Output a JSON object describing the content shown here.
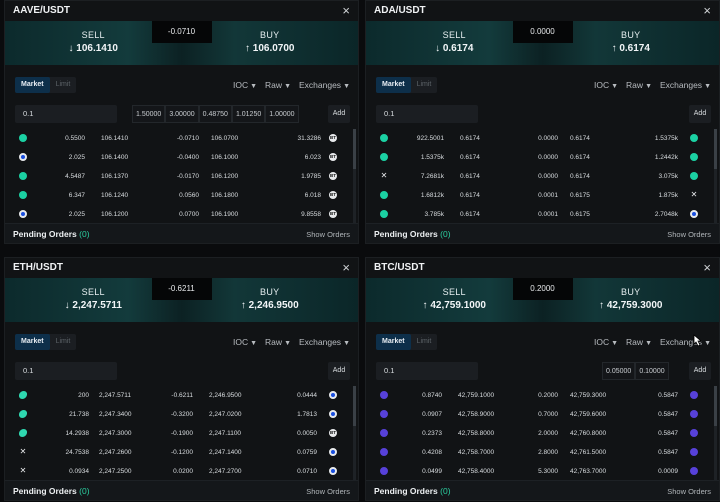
{
  "panels": [
    {
      "title": "AAVE/USDT",
      "sell_label": "SELL",
      "sell_price": "↓ 106.1410",
      "buy_label": "BUY",
      "buy_price": "↑ 106.0700",
      "spread": "-0.0710",
      "tabs": [
        "Market",
        "Limit"
      ],
      "options": [
        "IOC",
        "Raw",
        "Exchanges"
      ],
      "qty": "0.1",
      "presets": [
        "1.50000",
        "3.00000",
        "0.48750",
        "1.01250",
        "1.00000"
      ],
      "add": "Add",
      "rows": [
        {
          "l": "kc",
          "a": "0.5500",
          "b": "106.1410",
          "c": "-0.0710",
          "d": "106.0700",
          "e": "31.3286",
          "r": "bt"
        },
        {
          "l": "cb",
          "a": "2.025",
          "b": "106.1400",
          "c": "-0.0400",
          "d": "106.1000",
          "e": "6.023",
          "r": "bt"
        },
        {
          "l": "kc",
          "a": "4.5487",
          "b": "106.1370",
          "c": "-0.0170",
          "d": "106.1200",
          "e": "1.9785",
          "r": "bt"
        },
        {
          "l": "kc",
          "a": "6.347",
          "b": "106.1240",
          "c": "0.0560",
          "d": "106.1800",
          "e": "6.018",
          "r": "bt"
        },
        {
          "l": "cb",
          "a": "2.025",
          "b": "106.1200",
          "c": "0.0700",
          "d": "106.1900",
          "e": "9.8558",
          "r": "bt"
        }
      ],
      "pending_label": "Pending Orders",
      "pending_count": "(0)",
      "show_orders": "Show Orders"
    },
    {
      "title": "ADA/USDT",
      "sell_label": "SELL",
      "sell_price": "↓ 0.6174",
      "buy_label": "BUY",
      "buy_price": "↑ 0.6174",
      "spread": "0.0000",
      "tabs": [
        "Market",
        "Limit"
      ],
      "options": [
        "IOC",
        "Raw",
        "Exchanges"
      ],
      "qty": "0.1",
      "presets": [],
      "add": "Add",
      "rows": [
        {
          "l": "kc",
          "a": "922.5001",
          "b": "0.6174",
          "c": "0.0000",
          "d": "0.6174",
          "e": "1.5375k",
          "r": "kc"
        },
        {
          "l": "kc",
          "a": "1.5375k",
          "b": "0.6174",
          "c": "0.0000",
          "d": "0.6174",
          "e": "1.2442k",
          "r": "kc"
        },
        {
          "l": "okx",
          "a": "7.2681k",
          "b": "0.6174",
          "c": "0.0000",
          "d": "0.6174",
          "e": "3.075k",
          "r": "kc"
        },
        {
          "l": "kc",
          "a": "1.6812k",
          "b": "0.6174",
          "c": "0.0001",
          "d": "0.6175",
          "e": "1.875k",
          "r": "okx"
        },
        {
          "l": "kc",
          "a": "3.785k",
          "b": "0.6174",
          "c": "0.0001",
          "d": "0.6175",
          "e": "2.7048k",
          "r": "cb"
        }
      ],
      "pending_label": "Pending Orders",
      "pending_count": "(0)",
      "show_orders": "Show Orders"
    },
    {
      "title": "ETH/USDT",
      "sell_label": "SELL",
      "sell_price": "↓ 2,247.5711",
      "buy_label": "BUY",
      "buy_price": "↑ 2,246.9500",
      "spread": "-0.6211",
      "tabs": [
        "Market",
        "Limit"
      ],
      "options": [
        "IOC",
        "Raw",
        "Exchanges"
      ],
      "qty": "0.1",
      "presets": [],
      "add": "Add",
      "rows": [
        {
          "l": "cx",
          "a": "200",
          "b": "2,247.5711",
          "c": "-0.6211",
          "d": "2,246.9500",
          "e": "0.0444",
          "r": "cb"
        },
        {
          "l": "cx",
          "a": "21.738",
          "b": "2,247.3400",
          "c": "-0.3200",
          "d": "2,247.0200",
          "e": "1.7813",
          "r": "cb"
        },
        {
          "l": "cx",
          "a": "14.2938",
          "b": "2,247.3000",
          "c": "-0.1900",
          "d": "2,247.1100",
          "e": "0.0050",
          "r": "bt"
        },
        {
          "l": "okx",
          "a": "24.7538",
          "b": "2,247.2600",
          "c": "-0.1200",
          "d": "2,247.1400",
          "e": "0.0759",
          "r": "cb"
        },
        {
          "l": "okx",
          "a": "0.0934",
          "b": "2,247.2500",
          "c": "0.0200",
          "d": "2,247.2700",
          "e": "0.0710",
          "r": "cb"
        }
      ],
      "pending_label": "Pending Orders",
      "pending_count": "(0)",
      "show_orders": "Show Orders"
    },
    {
      "title": "BTC/USDT",
      "sell_label": "SELL",
      "sell_price": "↑ 42,759.1000",
      "buy_label": "BUY",
      "buy_price": "↑ 42,759.3000",
      "spread": "0.2000",
      "tabs": [
        "Market",
        "Limit"
      ],
      "options": [
        "IOC",
        "Raw",
        "Exchanges"
      ],
      "qty": "0.1",
      "presets": [
        "0.05000",
        "0.10000"
      ],
      "add": "Add",
      "rows": [
        {
          "l": "kr",
          "a": "0.8740",
          "b": "42,759.1000",
          "c": "0.2000",
          "d": "42,759.3000",
          "e": "0.5847",
          "r": "kr"
        },
        {
          "l": "kr",
          "a": "0.0907",
          "b": "42,758.9000",
          "c": "0.7000",
          "d": "42,759.6000",
          "e": "0.5847",
          "r": "kr"
        },
        {
          "l": "kr",
          "a": "0.2373",
          "b": "42,758.8000",
          "c": "2.0000",
          "d": "42,760.8000",
          "e": "0.5847",
          "r": "kr"
        },
        {
          "l": "kr",
          "a": "0.4208",
          "b": "42,758.7000",
          "c": "2.8000",
          "d": "42,761.5000",
          "e": "0.5847",
          "r": "kr"
        },
        {
          "l": "kr",
          "a": "0.0499",
          "b": "42,758.4000",
          "c": "5.3000",
          "d": "42,763.7000",
          "e": "0.0009",
          "r": "kr"
        }
      ],
      "pending_label": "Pending Orders",
      "pending_count": "(0)",
      "show_orders": "Show Orders"
    }
  ]
}
